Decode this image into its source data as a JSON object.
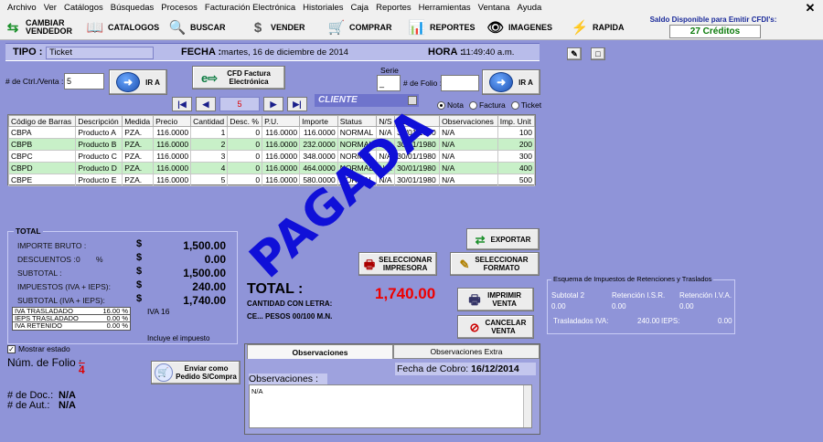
{
  "menu": [
    "Archivo",
    "Ver",
    "Catálogos",
    "Búsquedas",
    "Procesos",
    "Facturación Electrónica",
    "Historiales",
    "Caja",
    "Reportes",
    "Herramientas",
    "Ventana",
    "Ayuda"
  ],
  "toolbar": {
    "cambiar_vendedor": "CAMBIAR VENDEDOR",
    "catalogos": "CATALOGOS",
    "buscar": "BUSCAR",
    "vender": "VENDER",
    "comprar": "COMPRAR",
    "reportes": "REPORTES",
    "imagenes": "IMAGENES",
    "rapida": "RAPIDA"
  },
  "saldo": {
    "label": "Saldo Disponible para Emitir CFDI's:",
    "value": "27 Créditos"
  },
  "header": {
    "tipo_label": "TIPO :",
    "tipo_value": "Ticket",
    "fecha_label": "FECHA :",
    "fecha_value": "martes, 16 de diciembre de 2014",
    "hora_label": "HORA :",
    "hora_value": "11:49:40 a.m."
  },
  "controls": {
    "ctrl_venta_label": "# de Ctrl./Venta :",
    "ctrl_venta_value": "5",
    "ir_a": "IR A",
    "cfd_factura": "CFD Factura Electrónica",
    "serie_label": "Serie",
    "serie_value": "_",
    "folio_label": "# de Folio :",
    "folio_value": "",
    "record_indicator": "5",
    "cliente_label": "CLIENTE",
    "radios": [
      {
        "label": "Nota",
        "checked": true
      },
      {
        "label": "Factura",
        "checked": false
      },
      {
        "label": "Ticket",
        "checked": false
      }
    ]
  },
  "grid": {
    "columns": [
      "Código de Barras",
      "Descripción",
      "Medida",
      "Precio",
      "Cantidad",
      "Desc. %",
      "P.U.",
      "Importe",
      "Status",
      "N/S",
      "Cad.",
      "Observaciones",
      "Imp. Unit"
    ],
    "rows": [
      [
        "CBPA",
        "Producto A",
        "PZA.",
        "116.0000",
        "1",
        "0",
        "116.0000",
        "116.0000",
        "NORMAL",
        "N/A",
        "30/01/1980",
        "N/A",
        "100"
      ],
      [
        "CBPB",
        "Producto B",
        "PZA.",
        "116.0000",
        "2",
        "0",
        "116.0000",
        "232.0000",
        "NORMAL",
        "N/A",
        "30/01/1980",
        "N/A",
        "200"
      ],
      [
        "CBPC",
        "Producto C",
        "PZA.",
        "116.0000",
        "3",
        "0",
        "116.0000",
        "348.0000",
        "NORMAL",
        "N/A",
        "30/01/1980",
        "N/A",
        "300"
      ],
      [
        "CBPD",
        "Producto D",
        "PZA.",
        "116.0000",
        "4",
        "0",
        "116.0000",
        "464.0000",
        "NORMAL",
        "N/A",
        "30/01/1980",
        "N/A",
        "400"
      ],
      [
        "CBPE",
        "Producto E",
        "PZA.",
        "116.0000",
        "5",
        "0",
        "116.0000",
        "580.0000",
        "NORMAL",
        "N/A",
        "30/01/1980",
        "N/A",
        "500"
      ]
    ],
    "highlighted_rows": [
      1,
      3
    ]
  },
  "totals": {
    "title": "TOTAL",
    "importe_bruto_label": "IMPORTE BRUTO :",
    "importe_bruto": "1,500.00",
    "descuentos_label": "DESCUENTOS :",
    "descuentos_pct": "0",
    "descuentos_pct_sign": "%",
    "descuentos": "0.00",
    "subtotal_label": "SUBTOTAL :",
    "subtotal": "1,500.00",
    "impuestos_label": "IMPUESTOS (IVA + IEPS):",
    "impuestos": "240.00",
    "subtotal_iva_label": "SUBTOTAL (IVA + IEPS):",
    "subtotal_iva": "1,740.00",
    "currency": "$",
    "iva_rows": [
      [
        "IVA TRASLADADO",
        "16.00 %"
      ],
      [
        "IEPS TRASLADADO",
        "0.00 %"
      ],
      [
        "IVA RETENIDO",
        "0.00 %"
      ]
    ],
    "iva_label": "IVA 16",
    "incluye": "Incluye el impuesto"
  },
  "mostrar_estado": "Mostrar estado",
  "folio": {
    "label": "Núm. de Folio :",
    "value": "4"
  },
  "doc": {
    "doc_label": "# de Doc.:",
    "doc_value": "N/A",
    "aut_label": "# de Aut.:",
    "aut_value": "N/A"
  },
  "buttons": {
    "exportar": "EXPORTAR",
    "seleccionar_impresora": "SELECCIONAR IMPRESORA",
    "seleccionar_formato": "SELECCIONAR FORMATO",
    "imprimir_venta": "IMPRIMIR VENTA",
    "cancelar_venta": "CANCELAR VENTA",
    "enviar_pedido": "Enviar como Pedido S/Compra"
  },
  "total_panel": {
    "label": "TOTAL :",
    "value": "1,740.00",
    "cantidad": "CANTIDAD CON LETRA:",
    "letra": "CE... PESOS 00/100 M.N."
  },
  "stamp": "PAGADA",
  "tabs": [
    "Observaciones",
    "Observaciones Extra"
  ],
  "observaciones": {
    "fecha_cobro_label": "Fecha de Cobro:",
    "fecha_cobro_value": "16/12/2014",
    "label": "Observaciones :",
    "text": "N/A"
  },
  "retenciones": {
    "title": "Esquema de Impuestos de Retenciones y Traslados",
    "subtotal2_label": "Subtotal 2",
    "subtotal2_value": "0.00",
    "isr_label": "Retención I.S.R.",
    "isr_value": "0.00",
    "iva_label": "Retención I.V.A.",
    "iva_value": "0.00",
    "traslados_iva_label": "Trasladados IVA:",
    "traslados_iva_value": "240.00",
    "ieps_label": "IEPS:",
    "ieps_value": "0.00"
  }
}
